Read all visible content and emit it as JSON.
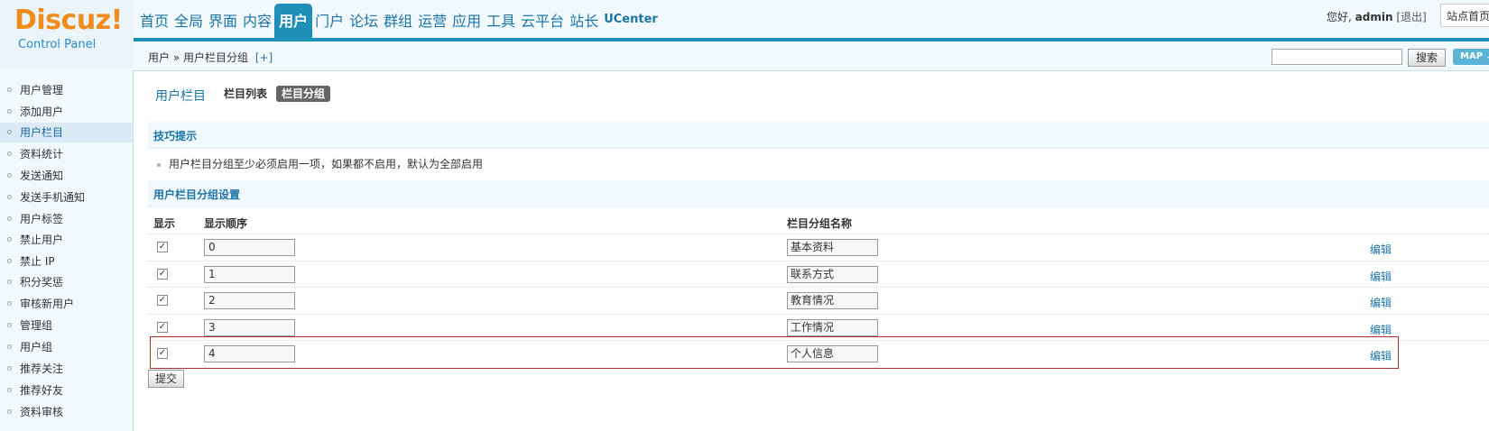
{
  "logo": {
    "brand": "Discuz!",
    "sub": "Control Panel"
  },
  "nav": {
    "items": [
      {
        "label": "首页"
      },
      {
        "label": "全局"
      },
      {
        "label": "界面"
      },
      {
        "label": "内容"
      },
      {
        "label": "用户"
      },
      {
        "label": "门户"
      },
      {
        "label": "论坛"
      },
      {
        "label": "群组"
      },
      {
        "label": "运营"
      },
      {
        "label": "应用"
      },
      {
        "label": "工具"
      },
      {
        "label": "云平台"
      },
      {
        "label": "站长"
      },
      {
        "label": "UCenter"
      }
    ],
    "active": "用户"
  },
  "user_bar": {
    "greeting": "您好,",
    "username": "admin",
    "logout": "[退出]",
    "site_home": "站点首页"
  },
  "breadcrumb": {
    "text": "用户 » 用户栏目分组",
    "add": "[+]"
  },
  "search": {
    "button": "搜索",
    "map": "MAP ↓"
  },
  "sidebar": {
    "items": [
      {
        "label": "用户管理"
      },
      {
        "label": "添加用户"
      },
      {
        "label": "用户栏目"
      },
      {
        "label": "资料统计"
      },
      {
        "label": "发送通知"
      },
      {
        "label": "发送手机通知"
      },
      {
        "label": "用户标签"
      },
      {
        "label": "禁止用户"
      },
      {
        "label": "禁止 IP"
      },
      {
        "label": "积分奖惩"
      },
      {
        "label": "审核新用户"
      },
      {
        "label": "管理组"
      },
      {
        "label": "用户组"
      },
      {
        "label": "推荐关注"
      },
      {
        "label": "推荐好友"
      },
      {
        "label": "资料审核"
      }
    ],
    "active": "用户栏目"
  },
  "main": {
    "title": "用户栏目",
    "tabs": [
      {
        "label": "栏目列表"
      },
      {
        "label": "栏目分组"
      }
    ],
    "tips_title": "技巧提示",
    "tip": "用户栏目分组至少必须启用一项，如果都不启用，默认为全部启用",
    "settings_title": "用户栏目分组设置",
    "columns": {
      "show": "显示",
      "order": "显示顺序",
      "name": "栏目分组名称"
    },
    "rows": [
      {
        "checked": true,
        "order": "0",
        "name": "基本资料",
        "action": "编辑"
      },
      {
        "checked": true,
        "order": "1",
        "name": "联系方式",
        "action": "编辑"
      },
      {
        "checked": true,
        "order": "2",
        "name": "教育情况",
        "action": "编辑"
      },
      {
        "checked": true,
        "order": "3",
        "name": "工作情况",
        "action": "编辑"
      },
      {
        "checked": true,
        "order": "4",
        "name": "个人信息",
        "action": "编辑"
      }
    ],
    "submit": "提交"
  }
}
